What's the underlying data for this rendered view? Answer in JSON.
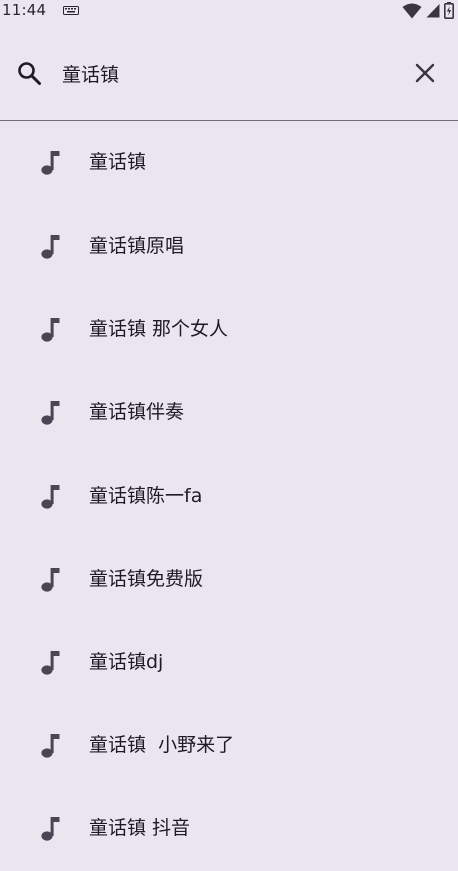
{
  "status_bar": {
    "time": "11:44",
    "icons": [
      "keyboard-icon",
      "wifi-icon",
      "signal-icon",
      "battery-charging-icon"
    ]
  },
  "search": {
    "query": "童话镇",
    "search_icon": "search-icon",
    "clear_icon": "close-icon"
  },
  "suggestions": [
    {
      "label": "童话镇",
      "icon": "music-note-icon"
    },
    {
      "label": "童话镇原唱",
      "icon": "music-note-icon"
    },
    {
      "label": "童话镇 那个女人",
      "icon": "music-note-icon"
    },
    {
      "label": "童话镇伴奏",
      "icon": "music-note-icon"
    },
    {
      "label": "童话镇陈一fa",
      "icon": "music-note-icon"
    },
    {
      "label": "童话镇免费版",
      "icon": "music-note-icon"
    },
    {
      "label": "童话镇dj",
      "icon": "music-note-icon"
    },
    {
      "label": "童话镇  小野来了",
      "icon": "music-note-icon"
    },
    {
      "label": "童话镇 抖音",
      "icon": "music-note-icon"
    }
  ],
  "colors": {
    "background": "#ebe5ef",
    "text": "#1f1b24",
    "icon": "#4a4553",
    "divider": "#6f6a75"
  }
}
